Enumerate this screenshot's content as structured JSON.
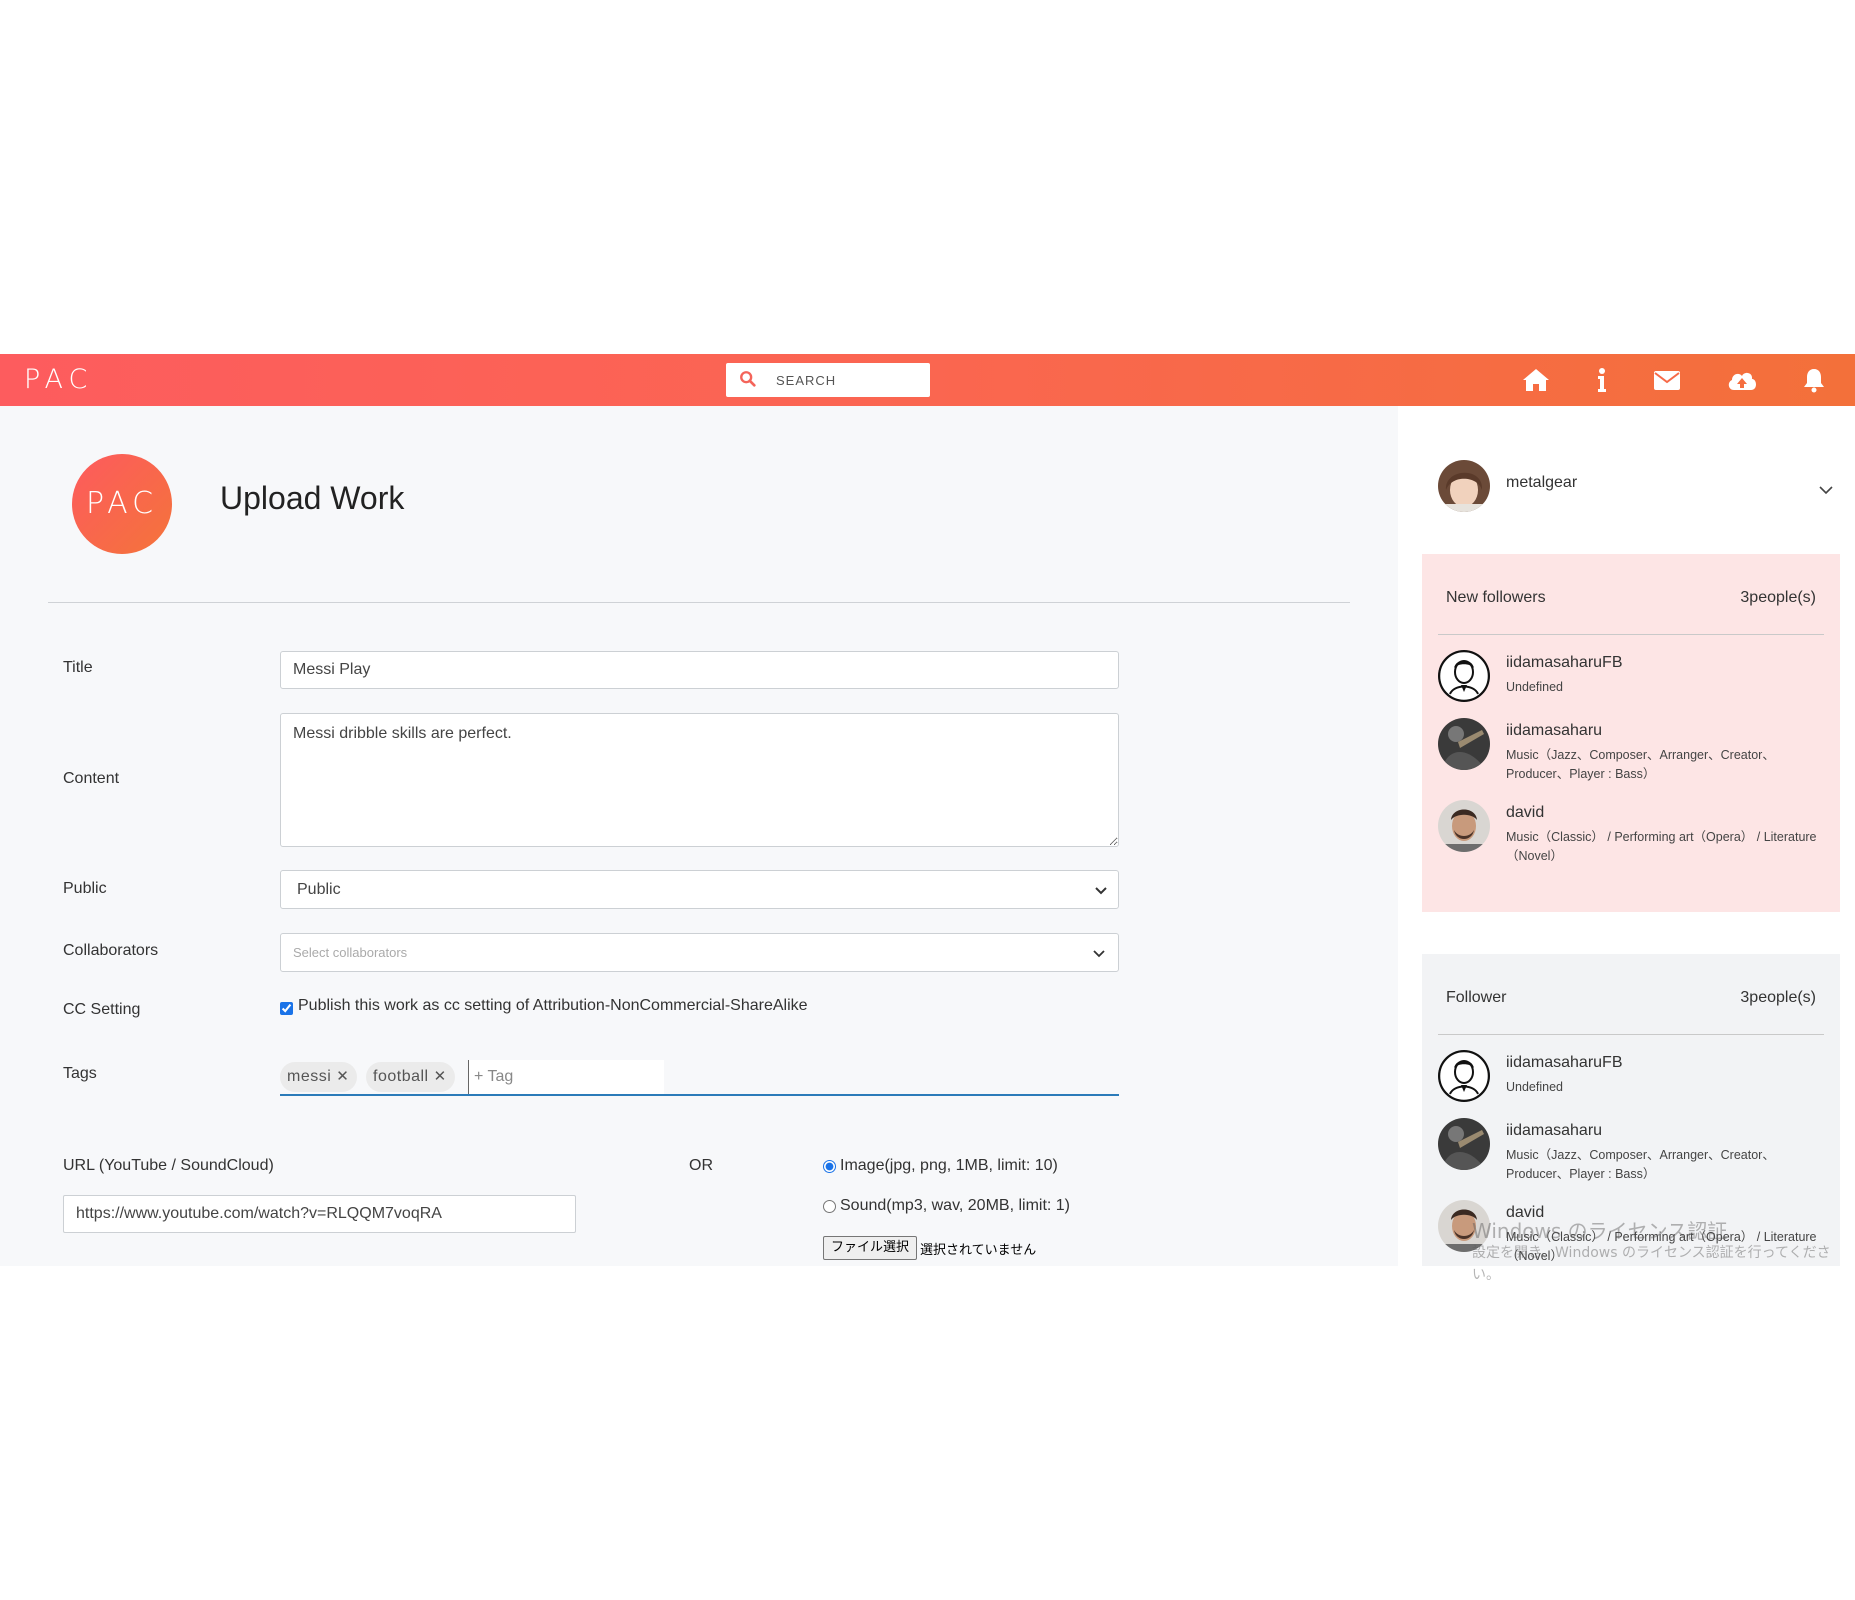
{
  "header": {
    "brand": "PAC",
    "search_placeholder": "SEARCH",
    "icons": [
      "home-icon",
      "info-icon",
      "mail-icon",
      "cloud-upload-icon",
      "bell-icon"
    ],
    "gradient": [
      "#fd5c5e",
      "#f3703a"
    ]
  },
  "page": {
    "logo_text": "PAC",
    "title": "Upload Work"
  },
  "form": {
    "title_label": "Title",
    "title_value": "Messi Play",
    "content_label": "Content",
    "content_value": "Messi dribble skills are perfect.",
    "public_label": "Public",
    "public_value": "Public",
    "collaborators_label": "Collaborators",
    "collaborators_placeholder": "Select collaborators",
    "cc_label": "CC Setting",
    "cc_checkbox_label": "Publish this work as cc setting of Attribution-NonCommercial-ShareAlike",
    "cc_checked": true,
    "tags_label": "Tags",
    "tags": [
      "messi",
      "football"
    ],
    "tag_placeholder": "+ Tag",
    "url_label": "URL (YouTube / SoundCloud)",
    "url_value": "https://www.youtube.com/watch?v=RLQQM7voqRA",
    "or_label": "OR",
    "radio_image": "Image(jpg, png, 1MB, limit: 10)",
    "radio_sound": "Sound(mp3, wav, 20MB, limit: 1)",
    "selected_media": "image",
    "file_button": "ファイル選択",
    "file_status": "選択されていません"
  },
  "sidebar": {
    "username": "metalgear",
    "new_followers": {
      "title": "New followers",
      "count": "3people(s)",
      "items": [
        {
          "name": "iidamasaharuFB",
          "desc": "Undefined"
        },
        {
          "name": "iidamasaharu",
          "desc": "Music（Jazz、Composer、Arranger、Creator、Producer、Player : Bass）"
        },
        {
          "name": "david",
          "desc": "Music（Classic） / Performing art（Opera） / Literature（Novel）"
        }
      ]
    },
    "followers": {
      "title": "Follower",
      "count": "3people(s)",
      "items": [
        {
          "name": "iidamasaharuFB",
          "desc": "Undefined"
        },
        {
          "name": "iidamasaharu",
          "desc": "Music（Jazz、Composer、Arranger、Creator、Producer、Player : Bass）"
        },
        {
          "name": "david",
          "desc": "Music（Classic） / Performing art（Opera） / Literature（Novel）"
        }
      ]
    }
  },
  "watermark": {
    "line1": "Windows のライセンス認証",
    "line2": "設定を開き、Windows のライセンス認証を行ってください。"
  }
}
